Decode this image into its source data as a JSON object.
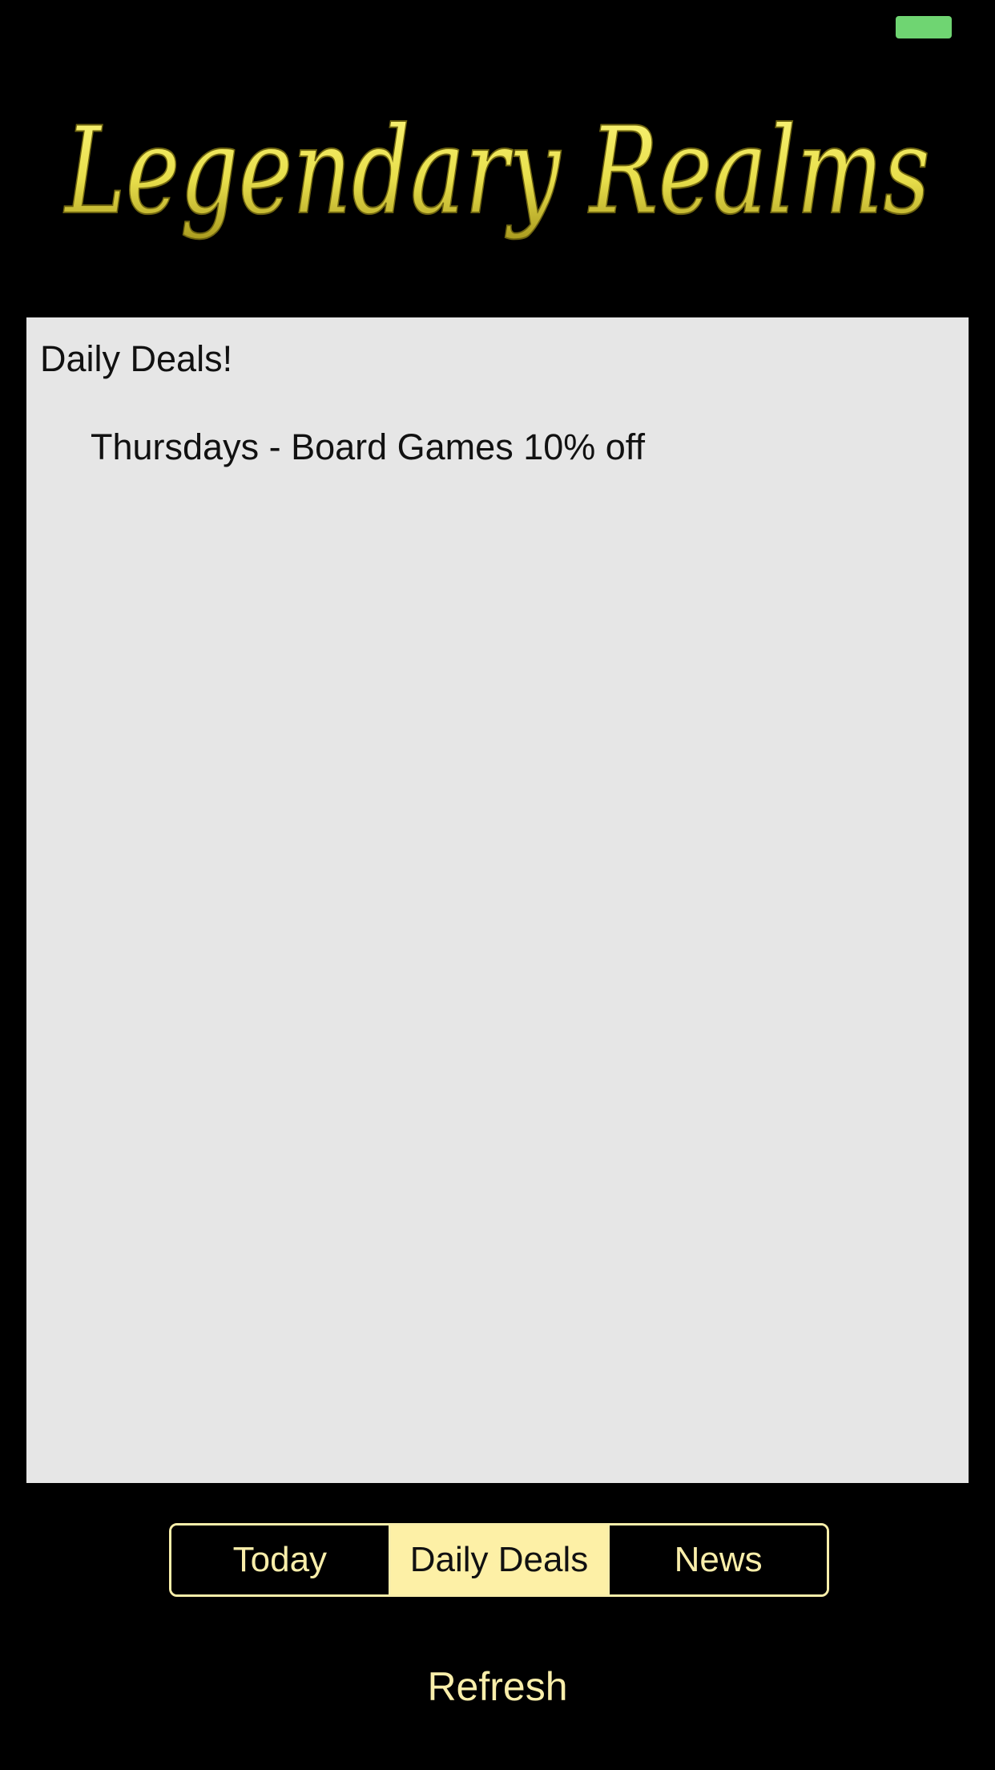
{
  "app": {
    "title": "Legendary Realms"
  },
  "status_bar": {
    "battery_icon": "battery-icon",
    "battery_color": "#6fd572"
  },
  "panel": {
    "heading": "Daily Deals!",
    "items": [
      "Thursdays - Board Games 10% off"
    ]
  },
  "tabs": {
    "items": [
      {
        "label": "Today",
        "selected": false
      },
      {
        "label": "Daily Deals",
        "selected": true
      },
      {
        "label": "News",
        "selected": false
      }
    ]
  },
  "actions": {
    "refresh_label": "Refresh"
  },
  "colors": {
    "background": "#000000",
    "panel": "#e6e6e6",
    "accent": "#f9eeaa",
    "selected_tab": "#fdf0a6",
    "logo_gold": "#e8df5a"
  }
}
